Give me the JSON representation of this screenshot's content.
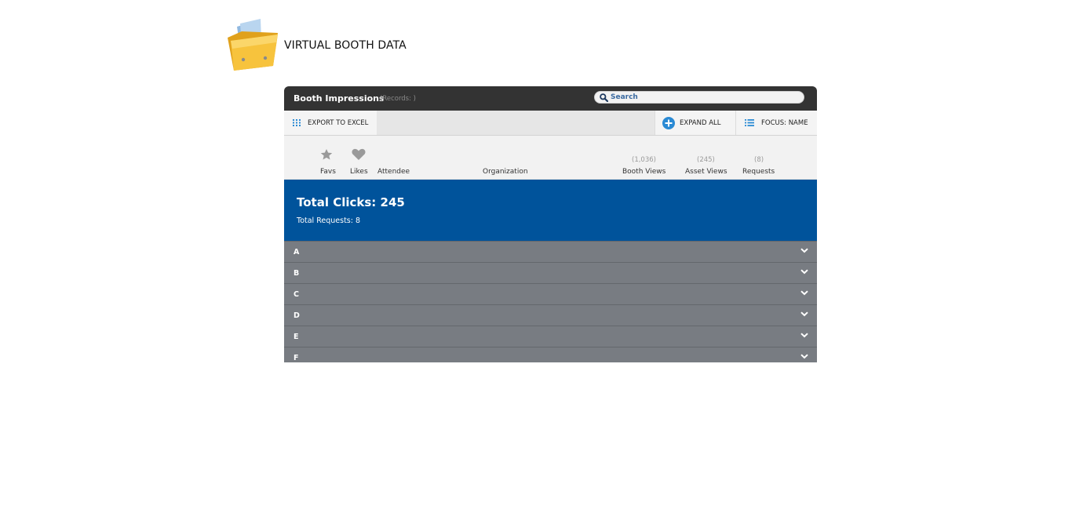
{
  "page": {
    "title": "VIRTUAL BOOTH DATA",
    "icon": "folder-icon"
  },
  "panel": {
    "title": "Booth Impressions",
    "records": "(Records: )",
    "search": {
      "placeholder": "Search",
      "value": ""
    }
  },
  "toolbar": {
    "export_label": "EXPORT TO EXCEL",
    "expand_label": "EXPAND ALL",
    "focus_label": "FOCUS: NAME"
  },
  "columns": {
    "favs": "Favs",
    "likes": "Likes",
    "attendee": "Attendee",
    "organization": "Organization",
    "booth_views": {
      "label": "Booth Views",
      "count": "(1,036)"
    },
    "asset_views": {
      "label": "Asset Views",
      "count": "(245)"
    },
    "requests": {
      "label": "Requests",
      "count": "(8)"
    }
  },
  "summary": {
    "total_clicks": "Total Clicks: 245",
    "total_requests": "Total Requests: 8"
  },
  "groups": [
    "A",
    "B",
    "C",
    "D",
    "E",
    "F"
  ],
  "colors": {
    "titlebar": "#333333",
    "summary": "#00539b",
    "group_row": "#787c82",
    "accent": "#2a8ad4"
  }
}
